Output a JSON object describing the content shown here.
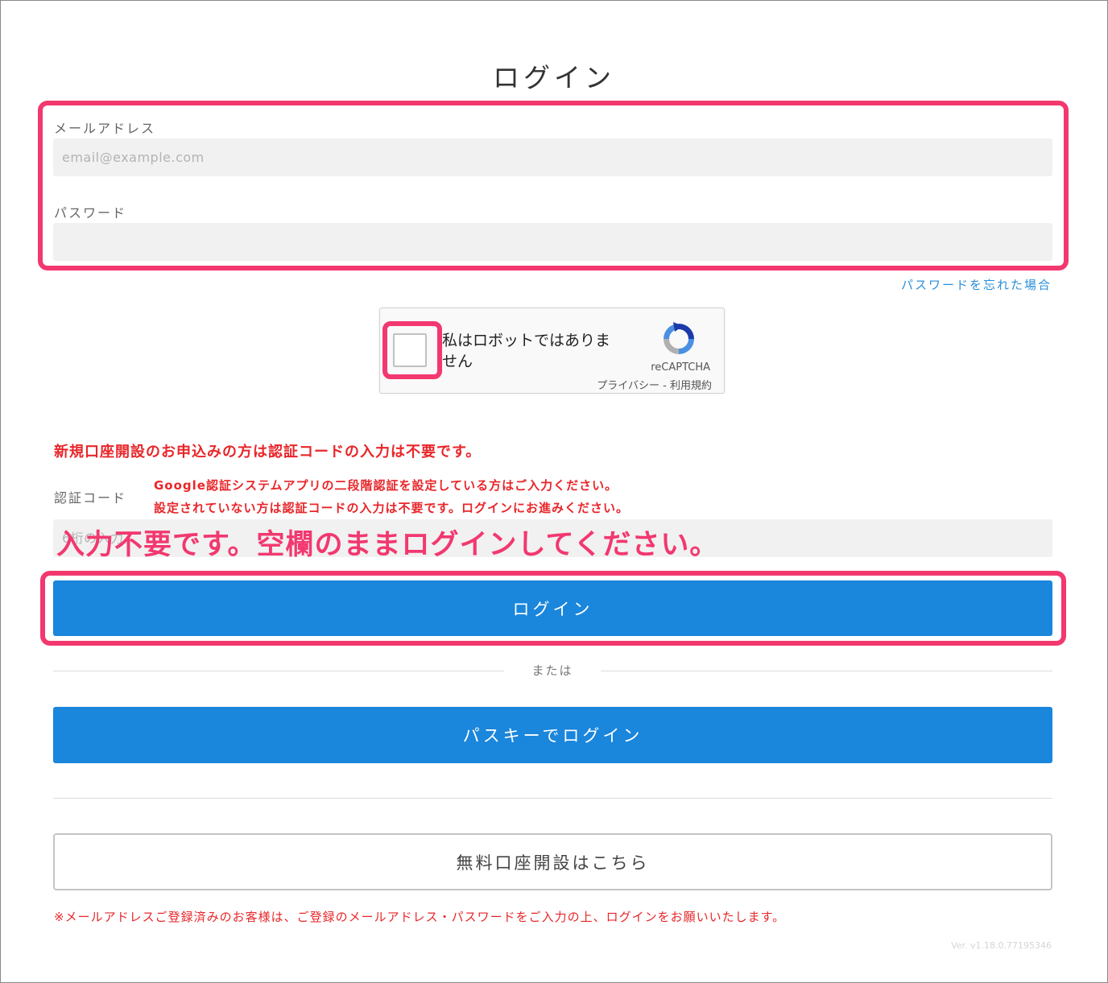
{
  "title": "ログイン",
  "email": {
    "label": "メールアドレス",
    "placeholder": "email@example.com"
  },
  "password": {
    "label": "パスワード",
    "placeholder": ""
  },
  "forgot_password": "パスワードを忘れた場合",
  "captcha": {
    "label": "私はロボットではありません",
    "brand": "reCAPTCHA",
    "links": "プライバシー - 利用規約"
  },
  "notice": "新規口座開設のお申込みの方は認証コードの入力は不要です。",
  "auth_code": {
    "label": "認証コード",
    "placeholder": "6桁の入力",
    "help_line1": "Google認証システムアプリの二段階認証を設定している方はご入力ください。",
    "help_line2": "設定されていない方は認証コードの入力は不要です。ログインにお進みください。"
  },
  "annotation_callout": "入力不要です。空欄のままログインしてください。",
  "login_button": "ログイン",
  "or_text": "または",
  "passkey_button": "パスキーでログイン",
  "open_account_button": "無料口座開設はこちら",
  "footer_note": "※メールアドレスご登録済みのお客様は、ご登録のメールアドレス・パスワードをご入力の上、ログインをお願いいたします。",
  "version": "Ver. v1.18.0.77195346",
  "colors": {
    "primary_button": "#1a86dc",
    "highlight": "#f2386f",
    "warning_text": "#e8262a",
    "link": "#2b8fd8"
  },
  "icons": [
    "recaptcha-logo-icon"
  ]
}
